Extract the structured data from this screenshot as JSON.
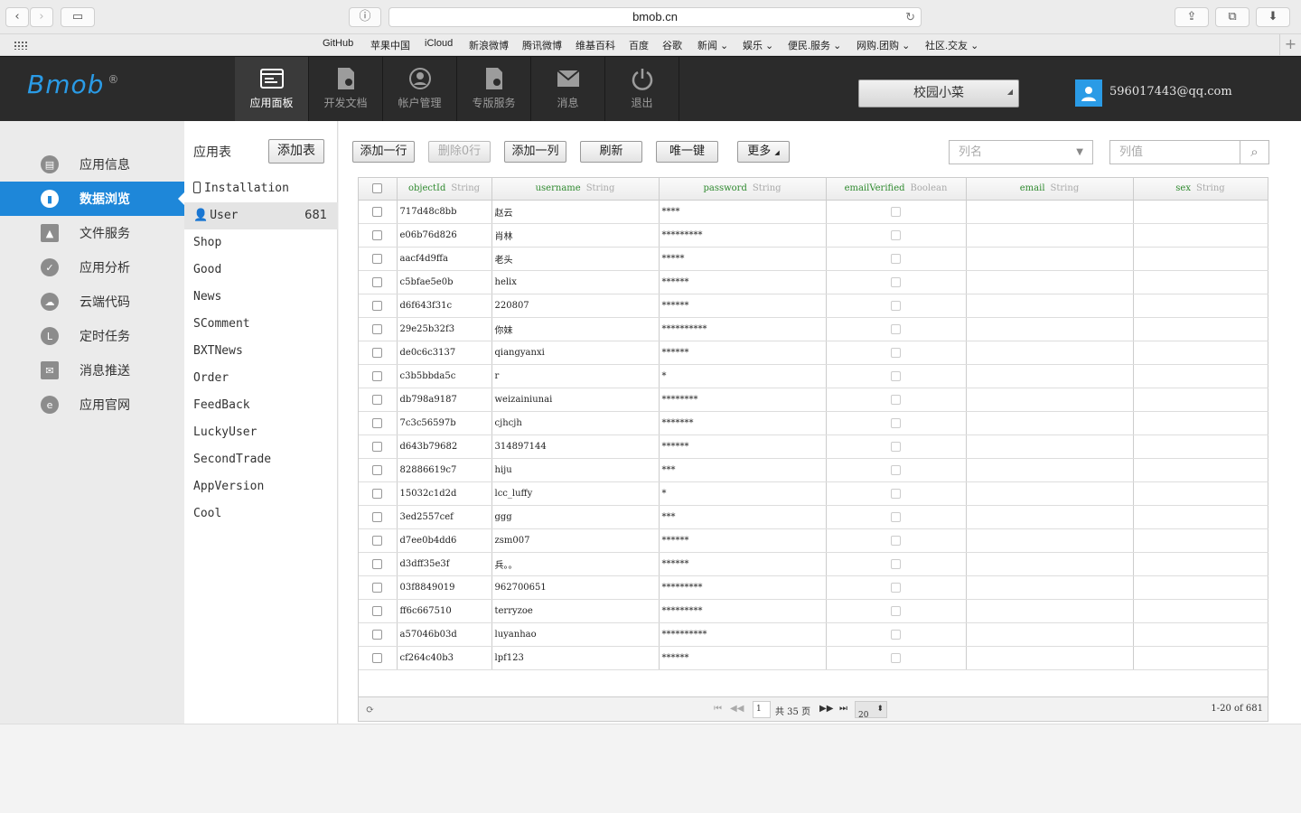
{
  "browser": {
    "url": "bmob.cn",
    "bookmarks": [
      "GitHub",
      "苹果中国",
      "iCloud",
      "新浪微博",
      "腾讯微博",
      "维基百科",
      "百度",
      "谷歌",
      "新闻",
      "娱乐",
      "便民.服务",
      "网购.团购",
      "社区.交友"
    ]
  },
  "header": {
    "logo": "Bmob",
    "nav": [
      "应用面板",
      "开发文档",
      "帐户管理",
      "专版服务",
      "消息",
      "退出"
    ],
    "app_name": "校园小菜",
    "user_email": "596017443@qq.com"
  },
  "sidebar": {
    "items": [
      "应用信息",
      "数据浏览",
      "文件服务",
      "应用分析",
      "云端代码",
      "定时任务",
      "消息推送",
      "应用官网"
    ]
  },
  "tables": {
    "heading": "应用表",
    "add_button": "添加表",
    "items": [
      "Installation",
      "User",
      "Shop",
      "Good",
      "News",
      "SComment",
      "BXTNews",
      "Order",
      "FeedBack",
      "LuckyUser",
      "SecondTrade",
      "AppVersion",
      "Cool"
    ],
    "user_count": "681"
  },
  "toolbar": {
    "add_row": "添加一行",
    "delete_rows": "删除0行",
    "add_column": "添加一列",
    "refresh": "刷新",
    "unique_key": "唯一键",
    "more": "更多",
    "column_name_placeholder": "列名",
    "column_value_placeholder": "列值"
  },
  "columns": [
    {
      "name": "objectId",
      "type": "String"
    },
    {
      "name": "username",
      "type": "String"
    },
    {
      "name": "password",
      "type": "String"
    },
    {
      "name": "emailVerified",
      "type": "Boolean"
    },
    {
      "name": "email",
      "type": "String"
    },
    {
      "name": "sex",
      "type": "String"
    }
  ],
  "rows": [
    [
      "717d48c8bb",
      "赵云",
      "****"
    ],
    [
      "e06b76d826",
      "肖林",
      "*********"
    ],
    [
      "aacf4d9ffa",
      "老头",
      "*****"
    ],
    [
      "c5bfae5e0b",
      "helix",
      "******"
    ],
    [
      "d6f643f31c",
      "220807",
      "******"
    ],
    [
      "29e25b32f3",
      "你妹",
      "**********"
    ],
    [
      "de0c6c3137",
      "qiangyanxi",
      "******"
    ],
    [
      "c3b5bbda5c",
      "r",
      "*"
    ],
    [
      "db798a9187",
      "weizainiunai",
      "********"
    ],
    [
      "7c3c56597b",
      "cjhcjh",
      "*******"
    ],
    [
      "d643b79682",
      "314897144",
      "******"
    ],
    [
      "82886619c7",
      "hiju",
      "***"
    ],
    [
      "15032c1d2d",
      "lcc_luffy",
      "*"
    ],
    [
      "3ed2557cef",
      "ggg",
      "***"
    ],
    [
      "d7ee0b4dd6",
      "zsm007",
      "******"
    ],
    [
      "d3dff35e3f",
      "兵。。",
      "******"
    ],
    [
      "03f8849019",
      "962700651",
      "*********"
    ],
    [
      "ff6c667510",
      "terryzoe",
      "*********"
    ],
    [
      "a57046b03d",
      "luyanhao",
      "**********"
    ],
    [
      "cf264c40b3",
      "lpf123",
      "******"
    ]
  ],
  "pager": {
    "page": "1",
    "total_pages": "共 35 页",
    "page_size": "20",
    "range": "1-20 of 681"
  }
}
